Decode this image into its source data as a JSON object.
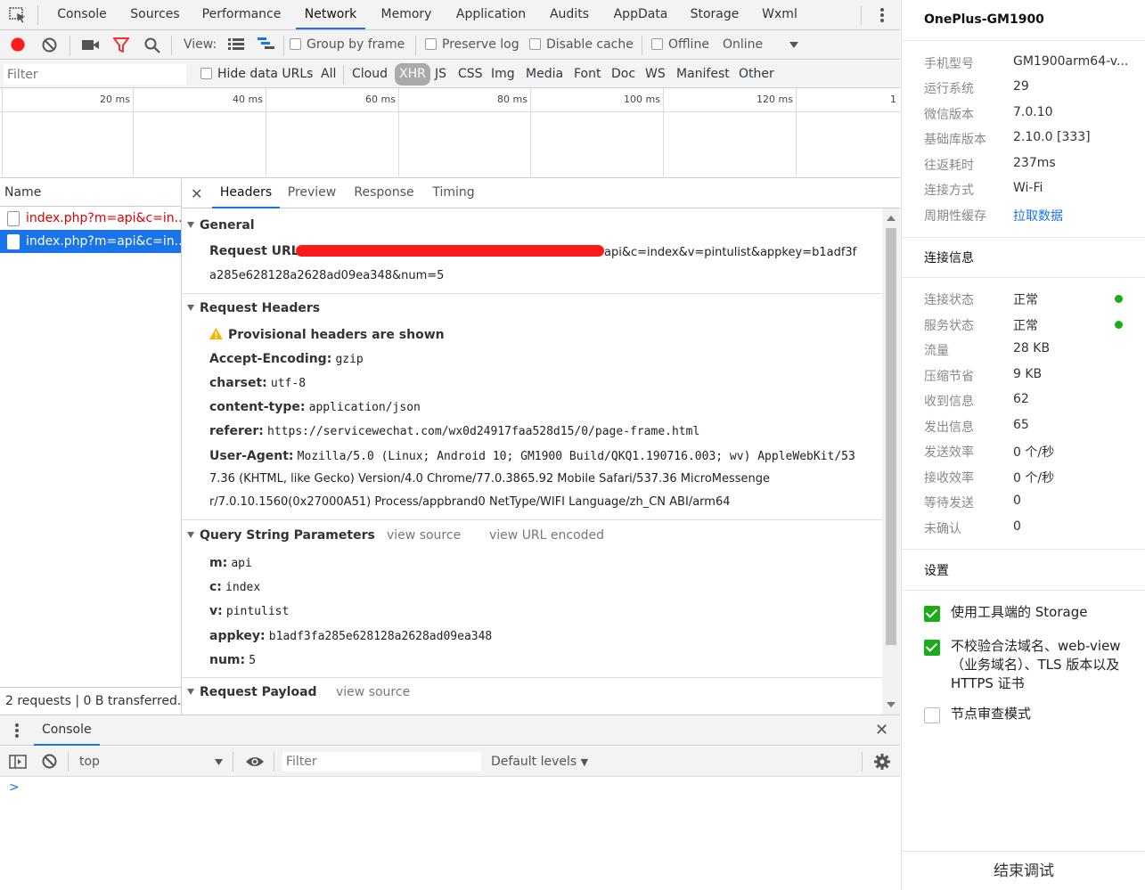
{
  "tabs": [
    "Console",
    "Sources",
    "Performance",
    "Network",
    "Memory",
    "Application",
    "Audits",
    "AppData",
    "Storage",
    "Wxml"
  ],
  "active_tab": "Network",
  "network_toolbar": {
    "view_label": "View:",
    "group_by_frame": "Group by frame",
    "preserve_log": "Preserve log",
    "disable_cache": "Disable cache",
    "offline": "Offline",
    "online": "Online"
  },
  "filter_bar": {
    "placeholder": "Filter",
    "hide_data_urls": "Hide data URLs",
    "types": [
      "All",
      "Cloud",
      "XHR",
      "JS",
      "CSS",
      "Img",
      "Media",
      "Font",
      "Doc",
      "WS",
      "Manifest",
      "Other"
    ],
    "active_type": "XHR"
  },
  "timeline": {
    "ticks": [
      "20 ms",
      "40 ms",
      "60 ms",
      "80 ms",
      "100 ms",
      "120 ms",
      "1"
    ]
  },
  "request_list": {
    "header": "Name",
    "items": [
      {
        "name": "index.php?m=api&c=in...",
        "state": "error"
      },
      {
        "name": "index.php?m=api&c=in...",
        "state": "selected"
      }
    ],
    "status": "2 requests  |  0 B transferred..."
  },
  "details": {
    "tabs": [
      "Headers",
      "Preview",
      "Response",
      "Timing"
    ],
    "active_tab": "Headers",
    "general": {
      "title": "General",
      "request_url_label": "Request URL:",
      "request_url_line1": "api&c=index&v=pintulist&appkey=b1adf3f",
      "request_url_line2": "a285e628128a2628ad09ea348&num=5"
    },
    "request_headers": {
      "title": "Request Headers",
      "warning": "Provisional headers are shown",
      "rows": [
        {
          "key": "Accept-Encoding:",
          "value": "gzip"
        },
        {
          "key": "charset:",
          "value": "utf-8"
        },
        {
          "key": "content-type:",
          "value": "application/json"
        },
        {
          "key": "referer:",
          "value": "https://servicewechat.com/wx0d24917faa528d15/0/page-frame.html"
        }
      ],
      "user_agent_key": "User-Agent:",
      "user_agent_line1": "Mozilla/5.0 (Linux; Android 10; GM1900 Build/QKQ1.190716.003; wv) AppleWebKit/53",
      "user_agent_line2": "7.36 (KHTML, like Gecko) Version/4.0 Chrome/77.0.3865.92 Mobile Safari/537.36 MicroMessenge",
      "user_agent_line3": "r/7.0.10.1560(0x27000A51) Process/appbrand0 NetType/WIFI Language/zh_CN ABI/arm64"
    },
    "query_params": {
      "title": "Query String Parameters",
      "view_source": "view source",
      "view_url_encoded": "view URL encoded",
      "rows": [
        {
          "key": "m:",
          "value": "api"
        },
        {
          "key": "c:",
          "value": "index"
        },
        {
          "key": "v:",
          "value": "pintulist"
        },
        {
          "key": "appkey:",
          "value": "b1adf3fa285e628128a2628ad09ea348"
        },
        {
          "key": "num:",
          "value": "5"
        }
      ]
    },
    "payload": {
      "title": "Request Payload",
      "view_source": "view source"
    }
  },
  "console_drawer": {
    "tab": "Console",
    "context": "top",
    "filter_placeholder": "Filter",
    "levels": "Default levels",
    "prompt": ">"
  },
  "side_panel": {
    "device": "OnePlus-GM1900",
    "info": [
      {
        "key": "手机型号",
        "value": "GM1900arm64-v..."
      },
      {
        "key": "运行系统",
        "value": "29"
      },
      {
        "key": "微信版本",
        "value": "7.0.10"
      },
      {
        "key": "基础库版本",
        "value": "2.10.0 [333]"
      },
      {
        "key": "往返耗时",
        "value": "237ms"
      },
      {
        "key": "连接方式",
        "value": "Wi-Fi"
      },
      {
        "key": "周期性缓存",
        "value": "拉取数据"
      }
    ],
    "conn_title": "连接信息",
    "conn": [
      {
        "key": "连接状态",
        "value": "正常"
      },
      {
        "key": "服务状态",
        "value": "正常"
      },
      {
        "key": "流量",
        "value": "28 KB"
      },
      {
        "key": "压缩节省",
        "value": "9 KB"
      },
      {
        "key": "收到信息",
        "value": "62"
      },
      {
        "key": "发出信息",
        "value": "65"
      },
      {
        "key": "发送效率",
        "value": "0 个/秒"
      },
      {
        "key": "接收效率",
        "value": "0 个/秒"
      },
      {
        "key": "等待发送",
        "value": "0"
      },
      {
        "key": "未确认",
        "value": "0"
      }
    ],
    "status_color": "#1aad19",
    "settings_title": "设置",
    "settings": [
      {
        "label": "使用工具端的 Storage",
        "checked": true
      },
      {
        "label": "不校验合法域名、web-view（业务域名）、TLS 版本以及 HTTPS 证书",
        "checked": true
      },
      {
        "label": "节点审查模式",
        "checked": false
      }
    ],
    "end_debug": "结束调试"
  }
}
